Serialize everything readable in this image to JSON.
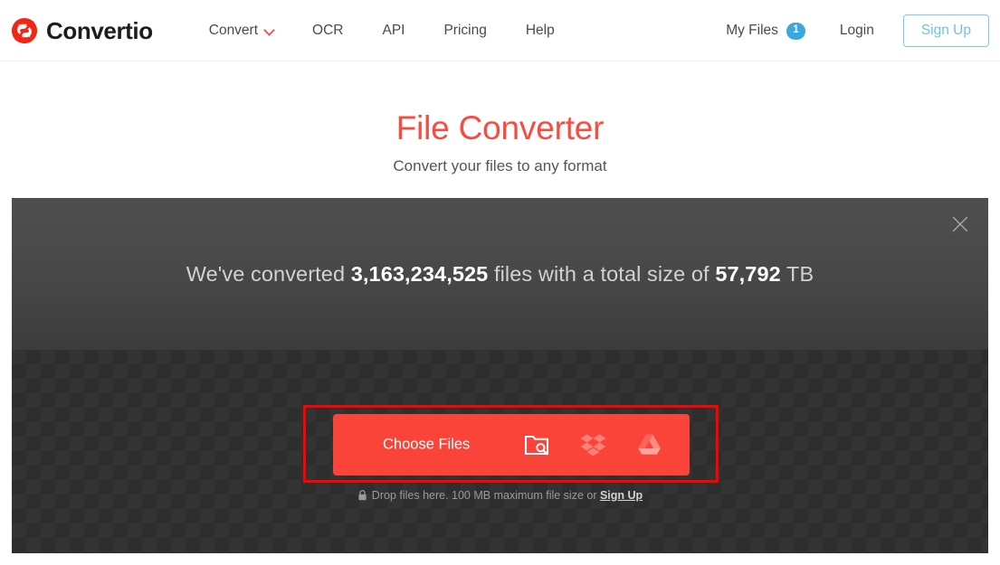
{
  "header": {
    "brand": {
      "name": "Convertio",
      "logo_icon": "convertio-logo-icon",
      "accent": "#fa4b41"
    },
    "nav": [
      {
        "label": "Convert",
        "has_caret": true
      },
      {
        "label": "OCR",
        "has_caret": false
      },
      {
        "label": "API",
        "has_caret": false
      },
      {
        "label": "Pricing",
        "has_caret": false
      },
      {
        "label": "Help",
        "has_caret": false
      }
    ],
    "my_files": {
      "label": "My Files",
      "count": "1",
      "badge_color": "#39a9dd"
    },
    "login_label": "Login",
    "signup_label": "Sign Up",
    "signup_color": "#6fc0e8"
  },
  "hero": {
    "title": "File Converter",
    "subtitle": "Convert your files to any format",
    "title_color": "#fa4b41"
  },
  "banner": {
    "prefix": "We've converted ",
    "files_count": "3,163,234,525",
    "middle": " files with a total size of ",
    "total_size": "57,792",
    "suffix": " TB",
    "close_icon": "close-icon"
  },
  "dropzone": {
    "choose_label": "Choose Files",
    "sources": [
      {
        "name": "local-folder",
        "icon": "folder-search-icon"
      },
      {
        "name": "dropbox",
        "icon": "dropbox-icon"
      },
      {
        "name": "google-drive",
        "icon": "google-drive-icon"
      }
    ],
    "hint_prefix": "Drop files here. 100 MB maximum file size or ",
    "hint_link": "Sign Up",
    "lock_icon": "lock-icon",
    "button_color": "#fb4439",
    "highlight_color": "#fd0000"
  }
}
